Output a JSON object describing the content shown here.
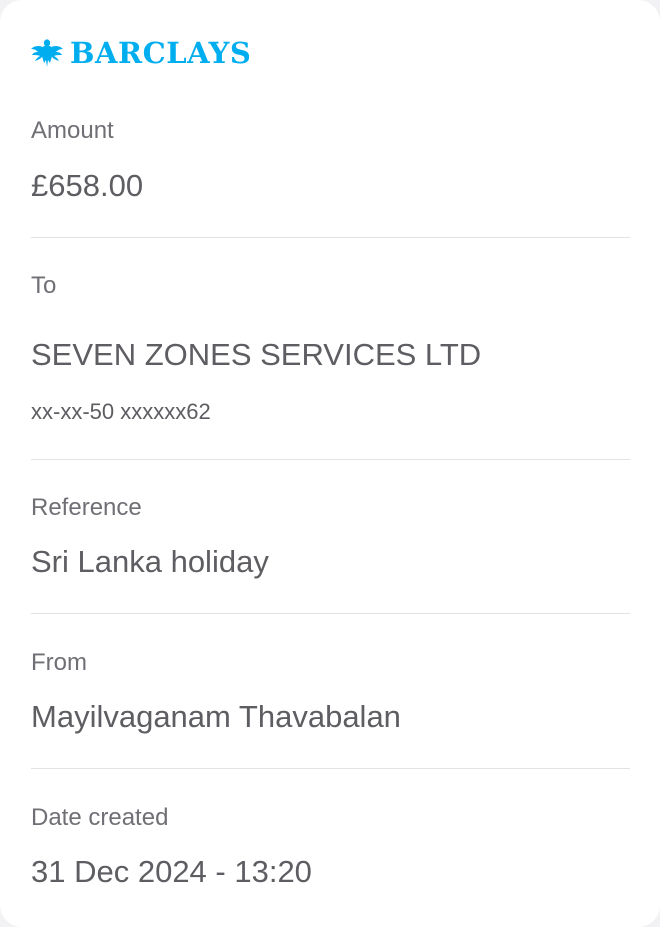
{
  "brand": {
    "name": "BARCLAYS",
    "logo_icon": "eagle-icon",
    "color": "#00aeef"
  },
  "colors": {
    "label": "#6f6f75",
    "value": "#5d5d62",
    "divider": "#e2e2e6",
    "card": "#ffffff"
  },
  "amount": {
    "label": "Amount",
    "value": "£658.00"
  },
  "to": {
    "label": "To",
    "name": "SEVEN ZONES SERVICES LTD",
    "account": "xx-xx-50 xxxxxx62"
  },
  "reference": {
    "label": "Reference",
    "value": "Sri Lanka holiday"
  },
  "from": {
    "label": "From",
    "value": "Mayilvaganam Thavabalan"
  },
  "date_created": {
    "label": "Date created",
    "value": "31 Dec 2024 - 13:20"
  }
}
